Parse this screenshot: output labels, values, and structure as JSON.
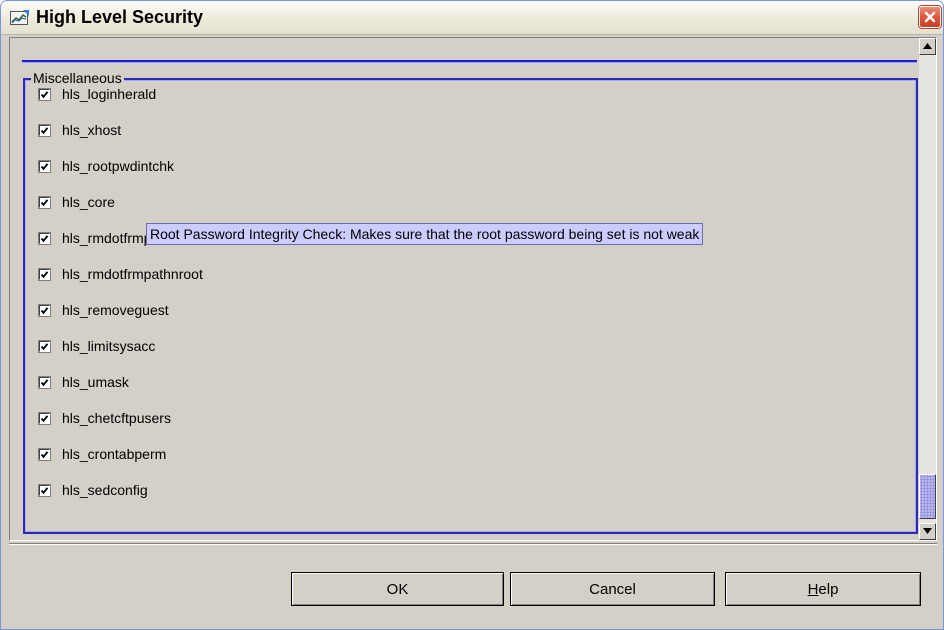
{
  "window": {
    "title": "High Level Security",
    "title_icon": "hls-chart-icon",
    "close_icon": "close-icon"
  },
  "group": {
    "legend": "Miscellaneous",
    "items": [
      {
        "label": "hls_loginherald",
        "checked": true
      },
      {
        "label": "hls_xhost",
        "checked": true
      },
      {
        "label": "hls_rootpwdintchk",
        "checked": true
      },
      {
        "label": "hls_core",
        "checked": true
      },
      {
        "label": "hls_rmdotfrmpathroot",
        "checked": true
      },
      {
        "label": "hls_rmdotfrmpathnroot",
        "checked": true
      },
      {
        "label": "hls_removeguest",
        "checked": true
      },
      {
        "label": "hls_limitsysacc",
        "checked": true
      },
      {
        "label": "hls_umask",
        "checked": true
      },
      {
        "label": "hls_chetcftpusers",
        "checked": true
      },
      {
        "label": "hls_crontabperm",
        "checked": true
      },
      {
        "label": "hls_sedconfig",
        "checked": true
      }
    ]
  },
  "tooltip": {
    "text": "Root Password Integrity Check: Makes sure that the root password being set is not weak"
  },
  "buttons": {
    "ok": "OK",
    "cancel": "Cancel",
    "help_mnemonic": "H",
    "help_rest": "elp"
  },
  "colors": {
    "group_border": "#2a2ab6",
    "tooltip_bg": "#ccccff",
    "scroll_thumb": "#b8b6f0",
    "close_button": "#d9553a"
  }
}
